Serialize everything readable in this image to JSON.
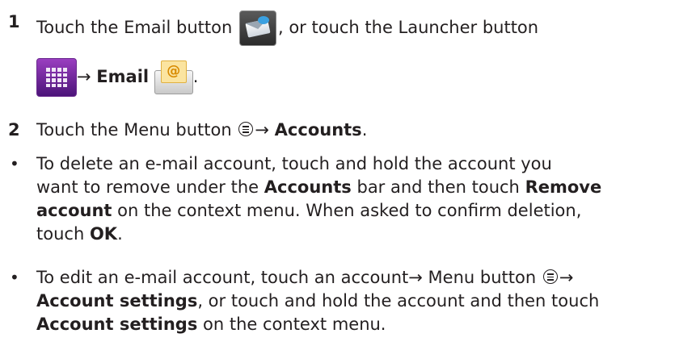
{
  "step1": {
    "number": "1",
    "text_a": "Touch the Email button",
    "text_b": ", or touch the Launcher button",
    "arrow": "→",
    "email_label": "Email",
    "period": ".",
    "icons": [
      "email-app-icon",
      "launcher-icon",
      "email-envelope-icon"
    ]
  },
  "step2": {
    "number": "2",
    "text_a": "Touch the Menu button",
    "arrow": "→",
    "accounts_label": "Accounts",
    "period": ".",
    "icon": "menu-circle-icon"
  },
  "bullet1": {
    "marker": "•",
    "line1": "To delete an e-mail account, touch and hold the account you",
    "line2_a": "want to remove under the",
    "accounts": "Accounts",
    "line2_b": "bar and then touch",
    "remove": "Remove",
    "account": "account",
    "line3_b": "on the context menu. When asked to confirm deletion,",
    "line4_a": "touch",
    "ok": "OK",
    "period": "."
  },
  "bullet2": {
    "marker": "•",
    "line1_a": "To edit an e-mail account, touch an account",
    "arrow": "→",
    "line1_b": "Menu button",
    "settings1": "Account settings",
    "line2_b": ", or touch and hold the account and then touch",
    "settings2": "Account settings",
    "line3_b": "on the context menu."
  }
}
